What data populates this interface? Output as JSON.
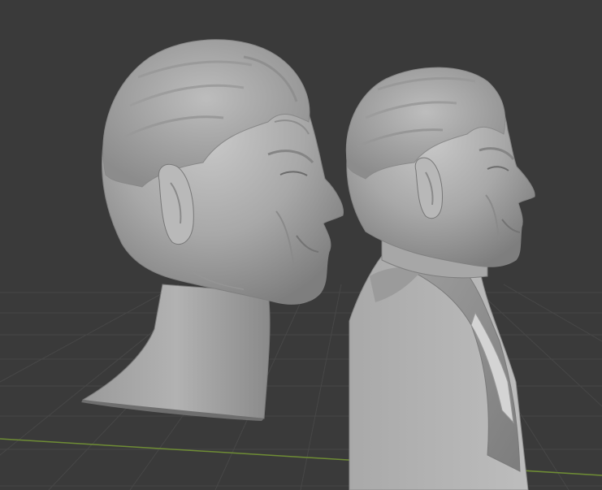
{
  "viewport": {
    "label": "",
    "background": "#3a3a3a",
    "grid_color": "#4a4a4a",
    "x_axis_color": "#7a9a3a"
  },
  "objects": [
    {
      "name": "head-sculpt",
      "material_color": "#a9a9a9"
    },
    {
      "name": "bust-sculpt",
      "material_color": "#b3b3b3"
    }
  ]
}
